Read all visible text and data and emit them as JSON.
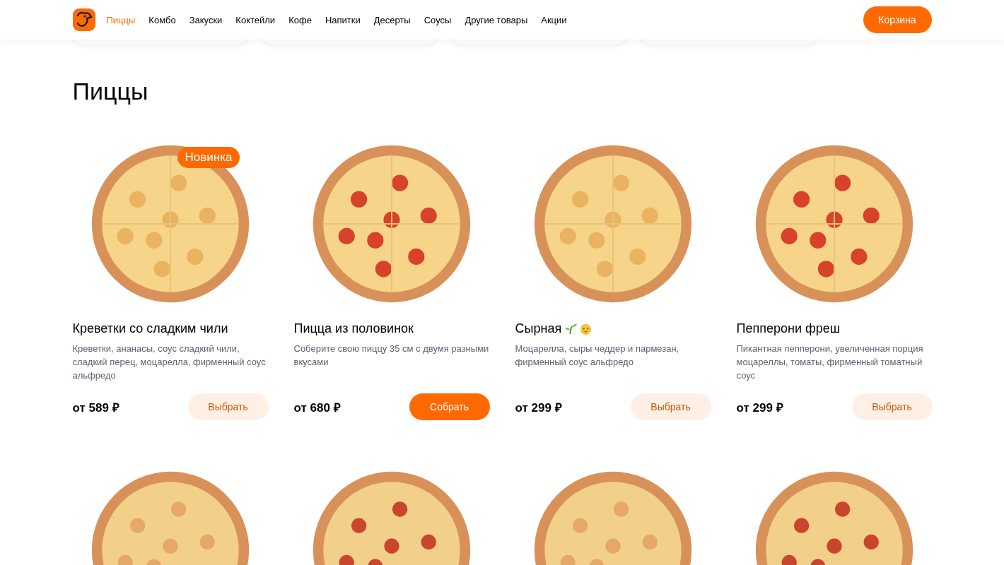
{
  "header": {
    "nav": [
      {
        "label": "Пиццы",
        "selected": true
      },
      {
        "label": "Комбо",
        "selected": false
      },
      {
        "label": "Закуски",
        "selected": false
      },
      {
        "label": "Коктейли",
        "selected": false
      },
      {
        "label": "Кофе",
        "selected": false
      },
      {
        "label": "Напитки",
        "selected": false
      },
      {
        "label": "Десерты",
        "selected": false
      },
      {
        "label": "Соусы",
        "selected": false
      },
      {
        "label": "Другие товары",
        "selected": false
      },
      {
        "label": "Акции",
        "selected": false
      }
    ],
    "cart_button": "Корзина"
  },
  "section_title": "Пиццы",
  "products": [
    {
      "name": "Креветки со сладким чили",
      "badge": "Новинка",
      "vegetarian": false,
      "kids": false,
      "description": "Креветки, ананасы, соус сладкий чили, сладкий перец, моцарелла, фирменный соус альфредо",
      "price": "от 589 ₽",
      "button": {
        "label": "Выбрать",
        "kind": "secondary"
      }
    },
    {
      "name": "Пицца из половинок",
      "vegetarian": false,
      "kids": false,
      "description": "Соберите свою пиццу 35 см с двумя разными вкусами",
      "price": "от 680 ₽",
      "button": {
        "label": "Собрать",
        "kind": "primary"
      }
    },
    {
      "name": "Сырная",
      "vegetarian": true,
      "kids": true,
      "description": "Моцарелла, сыры чеддер и пармезан, фирменный соус альфредо",
      "price": "от 299 ₽",
      "button": {
        "label": "Выбрать",
        "kind": "secondary"
      }
    },
    {
      "name": "Пепперони фреш",
      "vegetarian": false,
      "kids": false,
      "description": "Пикантная пепперони, увеличенная порция моцареллы, томаты, фирменный томатный соус",
      "price": "от 299 ₽",
      "button": {
        "label": "Выбрать",
        "kind": "secondary"
      }
    }
  ]
}
